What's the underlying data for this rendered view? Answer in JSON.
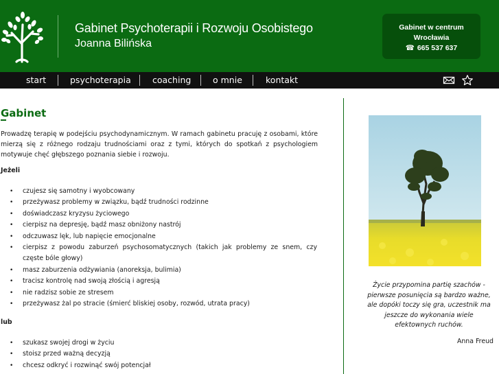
{
  "header": {
    "title": "Gabinet Psychoterapii i Rozwoju Osobistego",
    "subtitle": "Joanna Bilińska",
    "contact": {
      "line1": "Gabinet w centrum",
      "line2": "Wrocławia",
      "phone_icon": "☎",
      "phone": "665 537 637"
    },
    "logo_icon": "tree-logo-icon"
  },
  "nav": {
    "items": [
      "start",
      "psychoterapia",
      "coaching",
      "o mnie",
      "kontakt"
    ],
    "icons": [
      "envelope-icon",
      "star-icon"
    ]
  },
  "main": {
    "title": "Gabinet",
    "intro": "Prowadzę terapię w podejściu psychodynamicznym. W ramach gabinetu pracuję z osobami, które mierzą się z różnego rodzaju trudnościami oraz z tymi, których do spotkań z psychologiem motywuje chęć głębszego poznania siebie i rozwoju.",
    "section1_label": "Jeżeli",
    "list1": [
      "czujesz się samotny i wyobcowany",
      "przeżywasz problemy w związku, bądź trudności rodzinne",
      "doświadczasz kryzysu życiowego",
      "cierpisz na depresję, bądź masz obniżony nastrój",
      "odczuwasz lęk, lub napięcie emocjonalne",
      "cierpisz z powodu zaburzeń psychosomatycznych (takich jak problemy ze snem, czy częste bóle głowy)",
      "masz zaburzenia odżywiania (anoreksja, bulimia)",
      "tracisz kontrolę nad swoją złością i agresją",
      "nie radzisz sobie ze stresem",
      "przeżywasz żal po stracie (śmierć bliskiej osoby, rozwód, utrata pracy)"
    ],
    "section2_label": "lub",
    "list2": [
      "szukasz swojej drogi w życiu",
      "stoisz przed ważną decyzją",
      "chcesz odkryć i rozwinąć swój potencjał"
    ]
  },
  "sidebar": {
    "quote": "Życie przypomina partię szachów - pierwsze posunięcia są bardzo ważne, ale dopóki toczy się gra, uczestnik ma jeszcze do wykonania wiele efektownych ruchów.",
    "author": "Anna Freud"
  },
  "colors": {
    "header_green": "#0b6b12",
    "contact_box": "#064f0b",
    "nav_bg": "#111111",
    "title_green": "#0b6b12"
  }
}
